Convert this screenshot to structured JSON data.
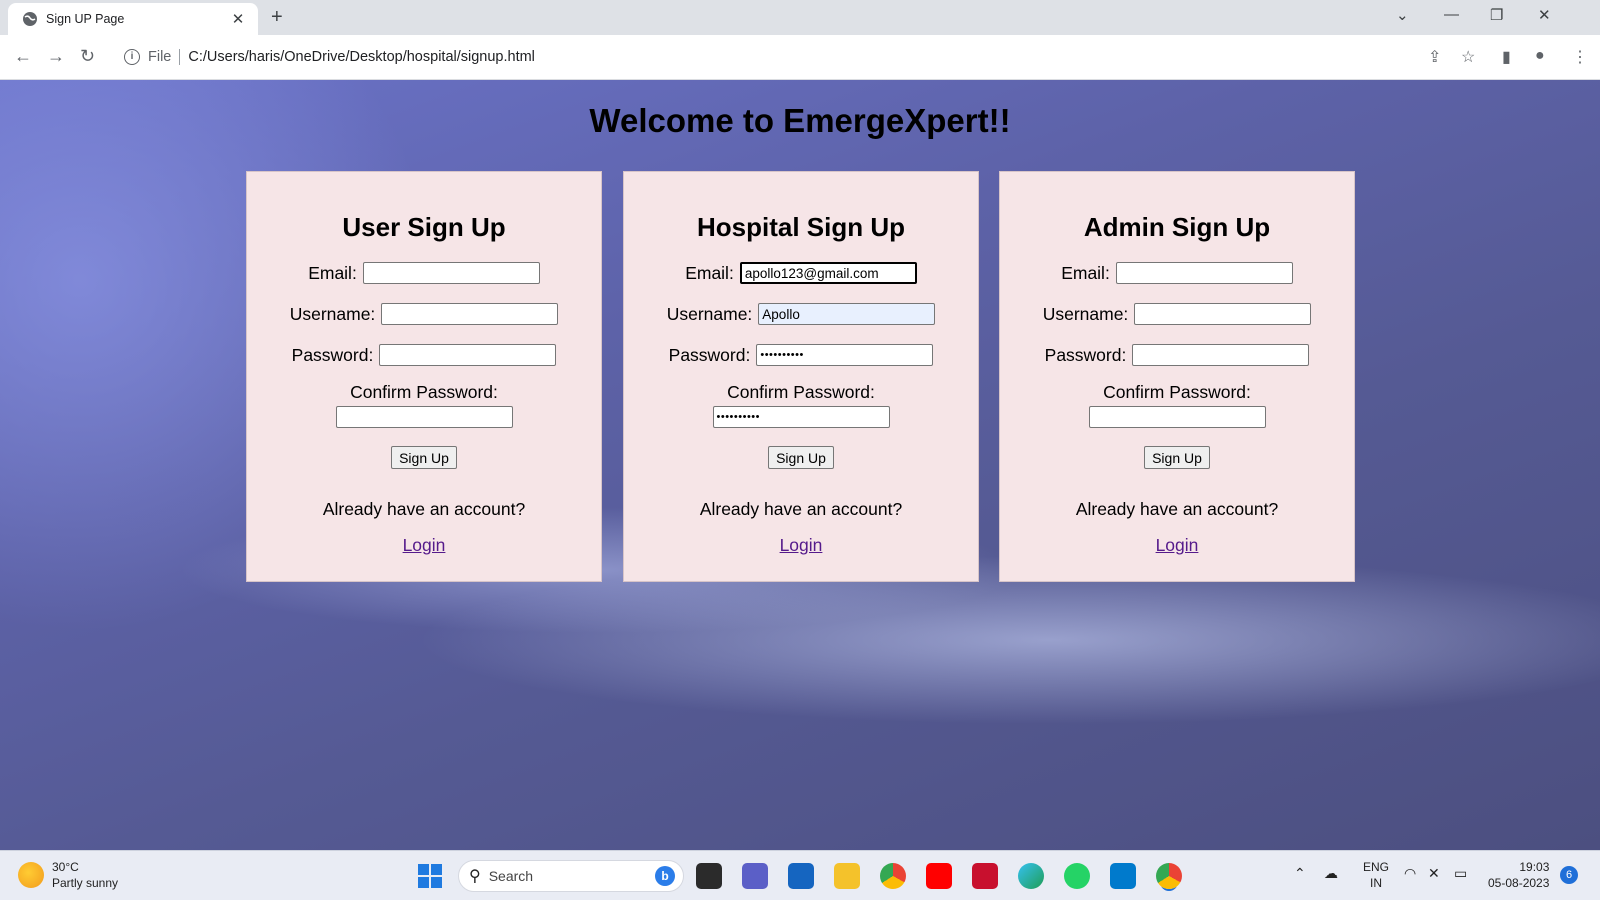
{
  "browser": {
    "tab_title": "Sign UP Page",
    "new_tab": "+",
    "omnibox_scheme": "File",
    "url": "C:/Users/haris/OneDrive/Desktop/hospital/signup.html"
  },
  "page": {
    "title": "Welcome to EmergeXpert!!",
    "cards": [
      {
        "heading": "User Sign Up",
        "email_label": "Email:",
        "email_value": "",
        "username_label": "Username:",
        "username_value": "",
        "password_label": "Password:",
        "password_value": "",
        "confirm_label": "Confirm Password:",
        "confirm_value": "",
        "button": "Sign Up",
        "already": "Already have an account?",
        "login": "Login"
      },
      {
        "heading": "Hospital Sign Up",
        "email_label": "Email:",
        "email_value": "apollo123@gmail.com",
        "username_label": "Username:",
        "username_value": "Apollo",
        "password_label": "Password:",
        "password_value": "••••••••••",
        "confirm_label": "Confirm Password:",
        "confirm_value": "••••••••••",
        "button": "Sign Up",
        "already": "Already have an account?",
        "login": "Login"
      },
      {
        "heading": "Admin Sign Up",
        "email_label": "Email:",
        "email_value": "",
        "username_label": "Username:",
        "username_value": "",
        "password_label": "Password:",
        "password_value": "",
        "confirm_label": "Confirm Password:",
        "confirm_value": "",
        "button": "Sign Up",
        "already": "Already have an account?",
        "login": "Login"
      }
    ]
  },
  "taskbar": {
    "weather_temp": "30°C",
    "weather_desc": "Partly sunny",
    "search_placeholder": "Search",
    "lang_top": "ENG",
    "lang_bottom": "IN",
    "time": "19:03",
    "date": "05-08-2023",
    "notifications": "6"
  },
  "colors": {
    "card_bg": "#f6e5e7",
    "link": "#551a8b",
    "autofill_bg": "#e8f0fe"
  }
}
